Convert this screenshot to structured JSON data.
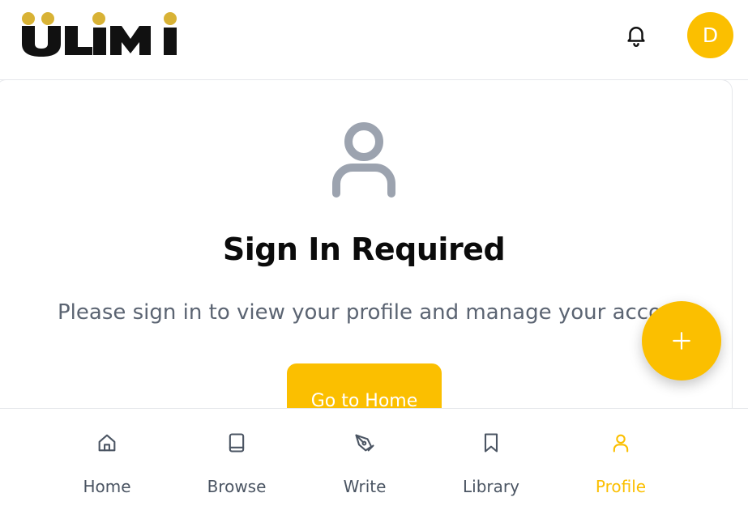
{
  "header": {
    "logo_text": "ULIMI",
    "avatar_initial": "D"
  },
  "main": {
    "title": "Sign In Required",
    "subtitle": "Please sign in to view your profile and manage your account",
    "button_label": "Go to Home"
  },
  "fab": {
    "label": "+"
  },
  "nav": {
    "items": [
      {
        "label": "Home",
        "icon": "home-icon"
      },
      {
        "label": "Browse",
        "icon": "book-icon"
      },
      {
        "label": "Write",
        "icon": "pen-icon"
      },
      {
        "label": "Library",
        "icon": "bookmark-icon"
      },
      {
        "label": "Profile",
        "icon": "user-icon",
        "active": true
      }
    ]
  },
  "colors": {
    "accent": "#fbbf00",
    "logo_dark": "#111111",
    "logo_gold": "#d8b235",
    "muted_text": "#5b6472",
    "icon_gray": "#9ca3af"
  }
}
